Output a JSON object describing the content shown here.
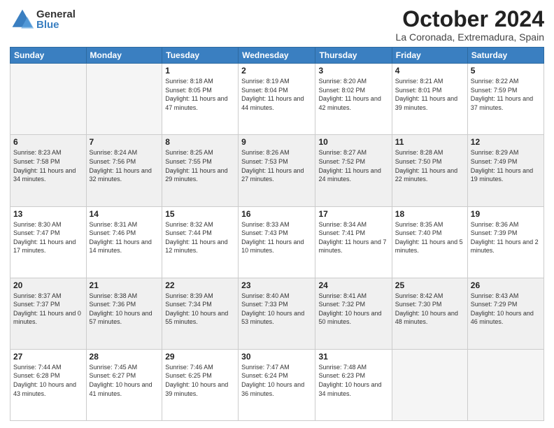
{
  "logo": {
    "general": "General",
    "blue": "Blue"
  },
  "header": {
    "month": "October 2024",
    "location": "La Coronada, Extremadura, Spain"
  },
  "weekdays": [
    "Sunday",
    "Monday",
    "Tuesday",
    "Wednesday",
    "Thursday",
    "Friday",
    "Saturday"
  ],
  "weeks": [
    [
      {
        "day": "",
        "info": ""
      },
      {
        "day": "",
        "info": ""
      },
      {
        "day": "1",
        "info": "Sunrise: 8:18 AM\nSunset: 8:05 PM\nDaylight: 11 hours and 47 minutes."
      },
      {
        "day": "2",
        "info": "Sunrise: 8:19 AM\nSunset: 8:04 PM\nDaylight: 11 hours and 44 minutes."
      },
      {
        "day": "3",
        "info": "Sunrise: 8:20 AM\nSunset: 8:02 PM\nDaylight: 11 hours and 42 minutes."
      },
      {
        "day": "4",
        "info": "Sunrise: 8:21 AM\nSunset: 8:01 PM\nDaylight: 11 hours and 39 minutes."
      },
      {
        "day": "5",
        "info": "Sunrise: 8:22 AM\nSunset: 7:59 PM\nDaylight: 11 hours and 37 minutes."
      }
    ],
    [
      {
        "day": "6",
        "info": "Sunrise: 8:23 AM\nSunset: 7:58 PM\nDaylight: 11 hours and 34 minutes."
      },
      {
        "day": "7",
        "info": "Sunrise: 8:24 AM\nSunset: 7:56 PM\nDaylight: 11 hours and 32 minutes."
      },
      {
        "day": "8",
        "info": "Sunrise: 8:25 AM\nSunset: 7:55 PM\nDaylight: 11 hours and 29 minutes."
      },
      {
        "day": "9",
        "info": "Sunrise: 8:26 AM\nSunset: 7:53 PM\nDaylight: 11 hours and 27 minutes."
      },
      {
        "day": "10",
        "info": "Sunrise: 8:27 AM\nSunset: 7:52 PM\nDaylight: 11 hours and 24 minutes."
      },
      {
        "day": "11",
        "info": "Sunrise: 8:28 AM\nSunset: 7:50 PM\nDaylight: 11 hours and 22 minutes."
      },
      {
        "day": "12",
        "info": "Sunrise: 8:29 AM\nSunset: 7:49 PM\nDaylight: 11 hours and 19 minutes."
      }
    ],
    [
      {
        "day": "13",
        "info": "Sunrise: 8:30 AM\nSunset: 7:47 PM\nDaylight: 11 hours and 17 minutes."
      },
      {
        "day": "14",
        "info": "Sunrise: 8:31 AM\nSunset: 7:46 PM\nDaylight: 11 hours and 14 minutes."
      },
      {
        "day": "15",
        "info": "Sunrise: 8:32 AM\nSunset: 7:44 PM\nDaylight: 11 hours and 12 minutes."
      },
      {
        "day": "16",
        "info": "Sunrise: 8:33 AM\nSunset: 7:43 PM\nDaylight: 11 hours and 10 minutes."
      },
      {
        "day": "17",
        "info": "Sunrise: 8:34 AM\nSunset: 7:41 PM\nDaylight: 11 hours and 7 minutes."
      },
      {
        "day": "18",
        "info": "Sunrise: 8:35 AM\nSunset: 7:40 PM\nDaylight: 11 hours and 5 minutes."
      },
      {
        "day": "19",
        "info": "Sunrise: 8:36 AM\nSunset: 7:39 PM\nDaylight: 11 hours and 2 minutes."
      }
    ],
    [
      {
        "day": "20",
        "info": "Sunrise: 8:37 AM\nSunset: 7:37 PM\nDaylight: 11 hours and 0 minutes."
      },
      {
        "day": "21",
        "info": "Sunrise: 8:38 AM\nSunset: 7:36 PM\nDaylight: 10 hours and 57 minutes."
      },
      {
        "day": "22",
        "info": "Sunrise: 8:39 AM\nSunset: 7:34 PM\nDaylight: 10 hours and 55 minutes."
      },
      {
        "day": "23",
        "info": "Sunrise: 8:40 AM\nSunset: 7:33 PM\nDaylight: 10 hours and 53 minutes."
      },
      {
        "day": "24",
        "info": "Sunrise: 8:41 AM\nSunset: 7:32 PM\nDaylight: 10 hours and 50 minutes."
      },
      {
        "day": "25",
        "info": "Sunrise: 8:42 AM\nSunset: 7:30 PM\nDaylight: 10 hours and 48 minutes."
      },
      {
        "day": "26",
        "info": "Sunrise: 8:43 AM\nSunset: 7:29 PM\nDaylight: 10 hours and 46 minutes."
      }
    ],
    [
      {
        "day": "27",
        "info": "Sunrise: 7:44 AM\nSunset: 6:28 PM\nDaylight: 10 hours and 43 minutes."
      },
      {
        "day": "28",
        "info": "Sunrise: 7:45 AM\nSunset: 6:27 PM\nDaylight: 10 hours and 41 minutes."
      },
      {
        "day": "29",
        "info": "Sunrise: 7:46 AM\nSunset: 6:25 PM\nDaylight: 10 hours and 39 minutes."
      },
      {
        "day": "30",
        "info": "Sunrise: 7:47 AM\nSunset: 6:24 PM\nDaylight: 10 hours and 36 minutes."
      },
      {
        "day": "31",
        "info": "Sunrise: 7:48 AM\nSunset: 6:23 PM\nDaylight: 10 hours and 34 minutes."
      },
      {
        "day": "",
        "info": ""
      },
      {
        "day": "",
        "info": ""
      }
    ]
  ]
}
